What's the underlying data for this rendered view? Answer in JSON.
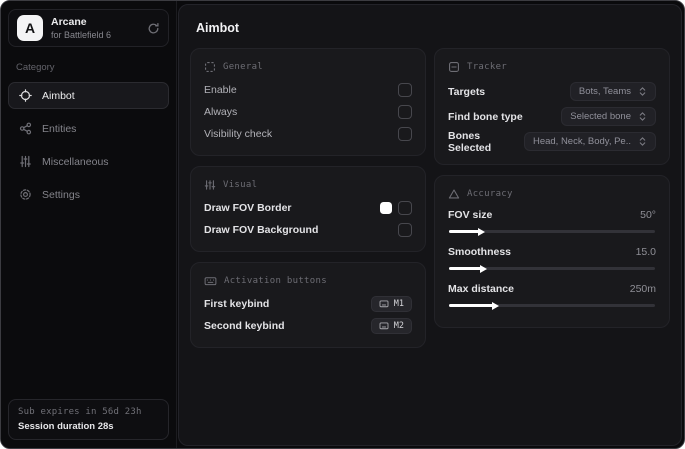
{
  "app": {
    "logo_letter": "A",
    "name": "Arcane",
    "subtitle": "for Battlefield 6"
  },
  "sidebar": {
    "category_label": "Category",
    "items": [
      {
        "label": "Aimbot"
      },
      {
        "label": "Entities"
      },
      {
        "label": "Miscellaneous"
      },
      {
        "label": "Settings"
      }
    ],
    "footer": {
      "sub_expires": "Sub expires in 56d 23h",
      "session_duration": "Session duration 28s"
    }
  },
  "main": {
    "page_title": "Aimbot",
    "general": {
      "title": "General",
      "rows": [
        {
          "label": "Enable",
          "checked": false
        },
        {
          "label": "Always",
          "checked": false
        },
        {
          "label": "Visibility check",
          "checked": false
        }
      ]
    },
    "visual": {
      "title": "Visual",
      "rows": [
        {
          "label": "Draw FOV Border",
          "checked": false,
          "swatch": "#ffffff"
        },
        {
          "label": "Draw FOV Background",
          "checked": false
        }
      ]
    },
    "activation": {
      "title": "Activation buttons",
      "rows": [
        {
          "label": "First keybind",
          "key": "M1"
        },
        {
          "label": "Second keybind",
          "key": "M2"
        }
      ]
    },
    "tracker": {
      "title": "Tracker",
      "rows": [
        {
          "label": "Targets",
          "value": "Bots, Teams"
        },
        {
          "label": "Find bone type",
          "value": "Selected bone"
        },
        {
          "label": "Bones Selected",
          "value": "Head, Neck, Body, Pe.."
        }
      ]
    },
    "accuracy": {
      "title": "Accuracy",
      "rows": [
        {
          "label": "FOV size",
          "value": "50°",
          "fill_pct": 15
        },
        {
          "label": "Smoothness",
          "value": "15.0",
          "fill_pct": 16
        },
        {
          "label": "Max distance",
          "value": "250m",
          "fill_pct": 22
        }
      ]
    }
  },
  "colors": {
    "swatch_white": "#ffffff",
    "sidebar_bg": "#0b0b0d",
    "panel_bg": "#141417",
    "card_bg": "#19191c"
  }
}
